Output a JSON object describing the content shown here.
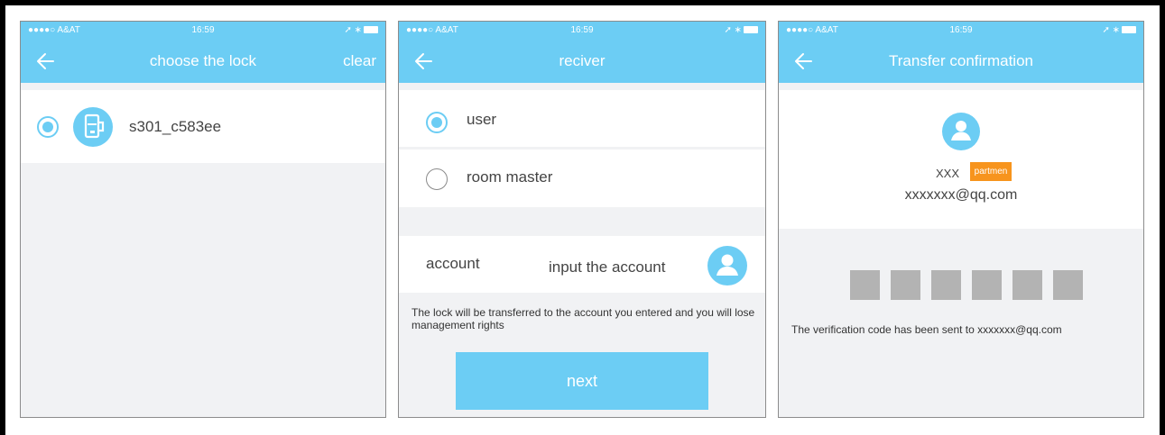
{
  "status_bar": {
    "carrier": "●●●●○ A&AT",
    "time": "16:59"
  },
  "screen_choose_lock": {
    "title": "choose the lock",
    "right_action": "clear",
    "lock_name": "s301_c583ee"
  },
  "screen_receiver": {
    "title": "reciver",
    "options": [
      {
        "label": "user",
        "selected": true
      },
      {
        "label": "room master",
        "selected": false
      }
    ],
    "account_label": "account",
    "account_placeholder": "input the account",
    "notice": "The lock will be transferred to the account you entered and you will lose management rights",
    "next_label": "next"
  },
  "screen_transfer": {
    "title": "Transfer confirmation",
    "user_name": "XXX",
    "badge": "partmen",
    "email": "xxxxxxx@qq.com",
    "code_boxes": 6,
    "verification_text": "The verification code has been sent to xxxxxxx@qq.com"
  },
  "colors": {
    "accent": "#6ccdf4",
    "background": "#f1f2f4",
    "badge": "#f7941d",
    "code_box": "#b3b3b3"
  }
}
